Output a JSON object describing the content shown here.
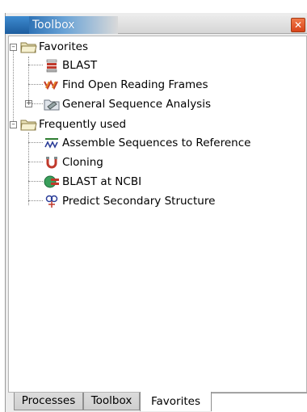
{
  "window": {
    "title": "Toolbox"
  },
  "tree": {
    "favorites": {
      "label": "Favorites",
      "children": [
        {
          "label": "BLAST",
          "icon": "blast-icon"
        },
        {
          "label": "Find Open Reading Frames",
          "icon": "orf-icon"
        },
        {
          "label": "General Sequence Analysis",
          "icon": "folder-tools-icon"
        }
      ]
    },
    "frequently_used": {
      "label": "Frequently used",
      "children": [
        {
          "label": "Assemble Sequences to Reference",
          "icon": "assemble-icon"
        },
        {
          "label": "Cloning",
          "icon": "cloning-icon"
        },
        {
          "label": "BLAST at NCBI",
          "icon": "blast-ncbi-icon"
        },
        {
          "label": "Predict Secondary Structure",
          "icon": "secondary-structure-icon"
        }
      ]
    }
  },
  "tabs": [
    {
      "label": "Processes",
      "active": false
    },
    {
      "label": "Toolbox",
      "active": false
    },
    {
      "label": "Favorites",
      "active": true
    }
  ]
}
